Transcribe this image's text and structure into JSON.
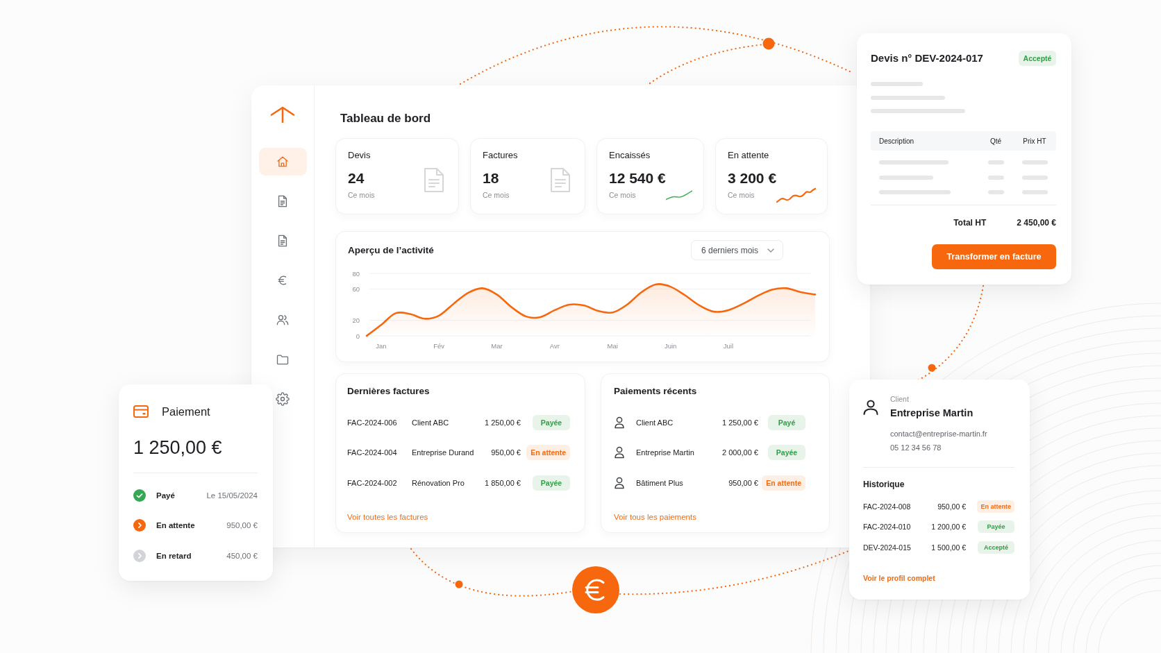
{
  "sidebar": {
    "items": [
      {
        "kind": "home",
        "selected": true
      },
      {
        "kind": "document",
        "selected": false
      },
      {
        "kind": "document",
        "selected": false
      },
      {
        "kind": "euro",
        "selected": false
      },
      {
        "kind": "users",
        "selected": false
      },
      {
        "kind": "folder",
        "selected": false
      },
      {
        "kind": "settings",
        "selected": false
      }
    ]
  },
  "dashboard": {
    "title": "Tableau de bord",
    "stats": [
      {
        "kind": "icon",
        "label": "Devis",
        "value": "24",
        "caption": "Ce mois"
      },
      {
        "kind": "icon",
        "label": "Factures",
        "value": "18",
        "caption": "Ce mois"
      },
      {
        "kind": "sparkline",
        "label": "Encaissés",
        "value": "12 540 €",
        "caption": "Ce mois",
        "color": "#3cb14f"
      },
      {
        "kind": "sparkline",
        "label": "En attente",
        "value": "3 200 €",
        "caption": "Ce mois",
        "color": "#f7670e"
      }
    ],
    "activity": {
      "period_select": {
        "value": "6 derniers mois"
      },
      "chart_data": {
        "type": "area",
        "title": "Aperçu de l’activité",
        "categories": [
          null,
          "Jan",
          null,
          null,
          null,
          "Fév",
          null,
          null,
          null,
          "Mar",
          null,
          null,
          null,
          "Avr",
          null,
          null,
          null,
          "Mai",
          null,
          null,
          null,
          "Juin",
          null,
          null,
          null,
          "Juil",
          null,
          null,
          null,
          null,
          null,
          null
        ],
        "series": [
          {
            "color": "#f7670e",
            "values": [
              0,
              14,
              29,
              28,
              22,
              26,
              41,
              55,
              61,
              53,
              37,
              25,
              24,
              33,
              40,
              39,
              32,
              30,
              40,
              56,
              66,
              63,
              52,
              39,
              31,
              33,
              41,
              51,
              59,
              61,
              56,
              53
            ]
          }
        ],
        "ylim": [
          0,
          80
        ],
        "yticks": [
          0,
          20,
          60,
          80
        ]
      }
    },
    "latest_invoices": {
      "title": "Dernières factures",
      "rows": [
        {
          "ref": "FAC-2024-006",
          "client": "Client ABC",
          "amount": "1 250,00 €",
          "status": "Payée",
          "color": "#2f9e44"
        },
        {
          "ref": "FAC-2024-004",
          "client": "Entreprise Durand",
          "amount": "950,00 €",
          "status": "En attente",
          "color": "#f26a12"
        },
        {
          "ref": "FAC-2024-002",
          "client": "Rénovation Pro",
          "amount": "1 850,00 €",
          "status": "Payée",
          "color": "#2f9e44"
        }
      ],
      "link": "Voir toutes les factures"
    },
    "recent_payments": {
      "title": "Paiements récents",
      "rows": [
        {
          "client": "Client ABC",
          "amount": "1 250,00 €",
          "status": "Payé",
          "color": "#2f9e44"
        },
        {
          "client": "Entreprise Martin",
          "amount": "2 000,00 €",
          "status": "Payée",
          "color": "#2f9e44"
        },
        {
          "client": "Bâtiment Plus",
          "amount": "950,00 €",
          "status": "En attente",
          "color": "#f26a12"
        }
      ],
      "link": "Voir tous les paiements"
    }
  },
  "quote_card": {
    "title": "Devis n° DEV-2024-017",
    "status": "Accepté",
    "color": "#2f9e44",
    "table": {
      "columns": [
        "Description",
        "Qté",
        "Prix HT"
      ]
    },
    "total_label": "Total HT",
    "total_value": "2 450,00 €",
    "button": "Transformer en facture"
  },
  "payment_card": {
    "title": "Paiement",
    "amount": "1 250,00 €",
    "steps": [
      {
        "label": "Payé",
        "value": "Le 15/05/2024",
        "done": true,
        "color": "#35a853"
      },
      {
        "label": "En attente",
        "value": "950,00 €",
        "done": false,
        "color": "#f7670e"
      },
      {
        "label": "En retard",
        "value": "450,00 €",
        "done": false,
        "color": "#d2d4d7"
      }
    ]
  },
  "client_card": {
    "label": "Client",
    "name": "Entreprise Martin",
    "email": "contact@entreprise-martin.fr",
    "phone": "05 12 34 56 78",
    "history_title": "Historique",
    "history": [
      {
        "ref": "FAC-2024-008",
        "amount": "950,00 €",
        "status": "En attente",
        "color": "#f26a12"
      },
      {
        "ref": "FAC-2024-010",
        "amount": "1 200,00 €",
        "status": "Payée",
        "color": "#2f9e44"
      },
      {
        "ref": "DEV-2024-015",
        "amount": "1 500,00 €",
        "status": "Accepté",
        "color": "#2f9e44"
      }
    ],
    "link": "Voir le profil complet"
  }
}
